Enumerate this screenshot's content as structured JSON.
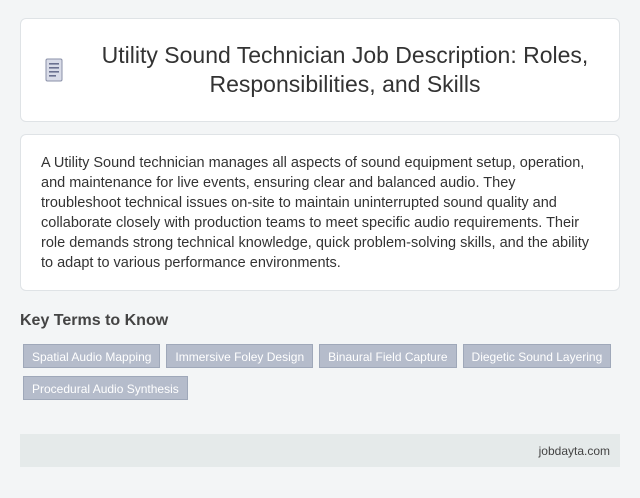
{
  "header": {
    "icon": "document-icon",
    "title": "Utility Sound Technician Job Description: Roles, Responsibilities, and Skills"
  },
  "description": {
    "text": "A Utility Sound technician manages all aspects of sound equipment setup, operation, and maintenance for live events, ensuring clear and balanced audio. They troubleshoot technical issues on-site to maintain uninterrupted sound quality and collaborate closely with production teams to meet specific audio requirements. Their role demands strong technical knowledge, quick problem-solving skills, and the ability to adapt to various performance environments."
  },
  "key_terms": {
    "heading": "Key Terms to Know",
    "tags": [
      "Spatial Audio Mapping",
      "Immersive Foley Design",
      "Binaural Field Capture",
      "Diegetic Sound Layering",
      "Procedural Audio Synthesis"
    ]
  },
  "footer": {
    "site": "jobdayta.com"
  },
  "colors": {
    "tag_background": "#b5bccb",
    "footer_background": "#e5eaea",
    "page_background": "#f3f5f6"
  }
}
